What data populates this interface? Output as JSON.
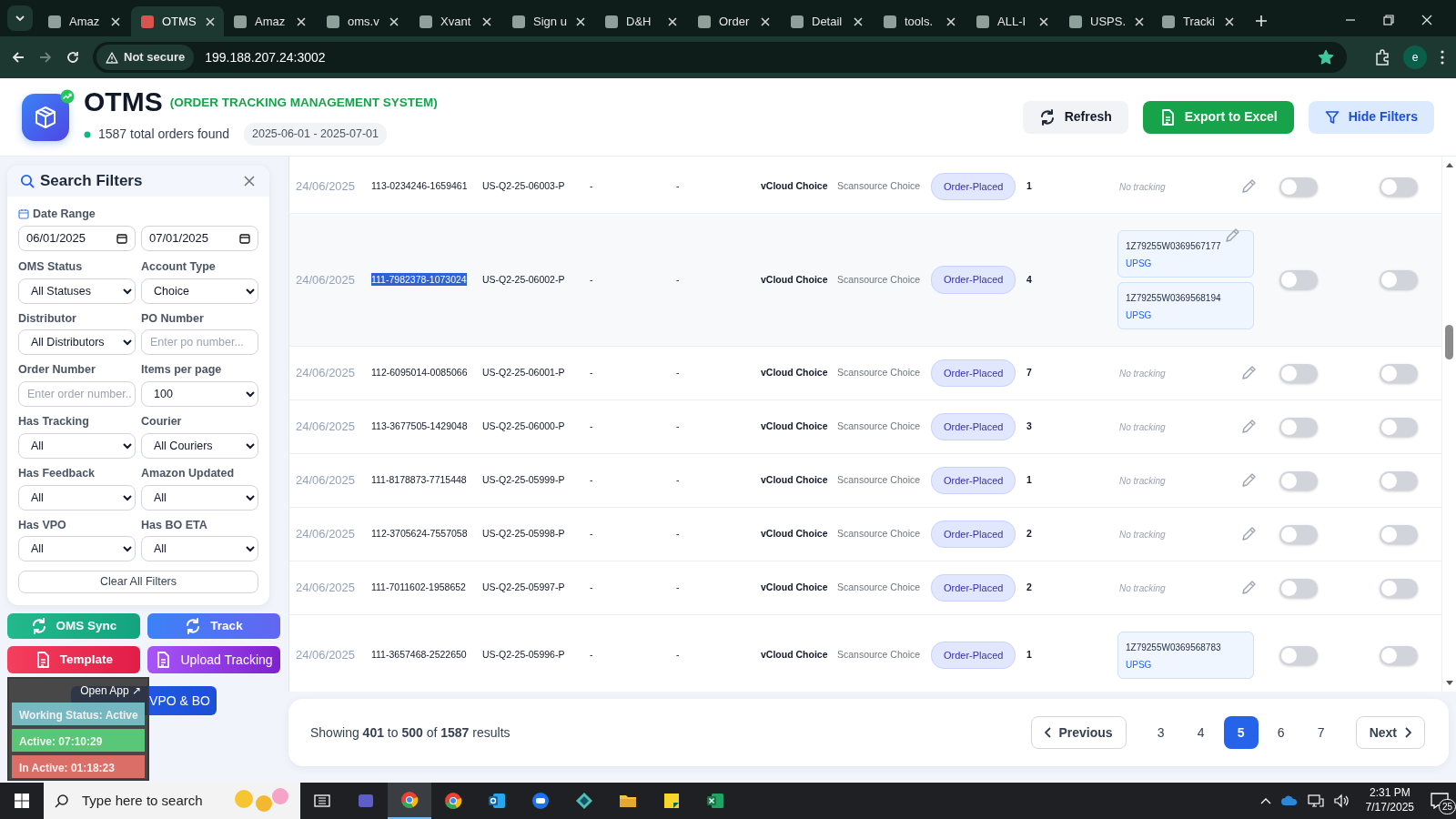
{
  "browser": {
    "tabs": [
      {
        "title": "Amaz",
        "selected": false
      },
      {
        "title": "OTMS",
        "selected": true
      },
      {
        "title": "Amaz",
        "selected": false
      },
      {
        "title": "oms.v",
        "selected": false
      },
      {
        "title": "Xvant",
        "selected": false
      },
      {
        "title": "Sign u",
        "selected": false
      },
      {
        "title": "D&H",
        "selected": false
      },
      {
        "title": "Order",
        "selected": false
      },
      {
        "title": "Detail",
        "selected": false
      },
      {
        "title": "tools.",
        "selected": false
      },
      {
        "title": "ALL-I",
        "selected": false
      },
      {
        "title": "USPS.",
        "selected": false
      },
      {
        "title": "Tracki",
        "selected": false
      }
    ],
    "security_label": "Not secure",
    "url": "199.188.207.24:3002",
    "bookmarked": true,
    "profile_initial": "e"
  },
  "header": {
    "title": "OTMS",
    "subtitle": "(ORDER TRACKING MANAGEMENT SYSTEM)",
    "order_count": "1587 total orders found",
    "date_range": "2025-06-01 - 2025-07-01",
    "buttons": [
      {
        "label": "Refresh",
        "kind": "refresh"
      },
      {
        "label": "Export to Excel",
        "kind": "export"
      },
      {
        "label": "Hide Filters",
        "kind": "filter"
      }
    ]
  },
  "filters": {
    "title": "Search Filters",
    "date_range_label": "Date Range",
    "date_from": "06/01/2025",
    "date_to": "07/01/2025",
    "fields": [
      {
        "label": "OMS Status",
        "kind": "select",
        "value": "All Statuses"
      },
      {
        "label": "Account Type",
        "kind": "select",
        "value": "Choice"
      },
      {
        "label": "Distributor",
        "kind": "select",
        "value": "All Distributors"
      },
      {
        "label": "PO Number",
        "kind": "input",
        "placeholder": "Enter po number..."
      },
      {
        "label": "Order Number",
        "kind": "input",
        "placeholder": "Enter order number.."
      },
      {
        "label": "Items per page",
        "kind": "select",
        "value": "100"
      },
      {
        "label": "Has Tracking",
        "kind": "select",
        "value": "All"
      },
      {
        "label": "Courier",
        "kind": "select",
        "value": "All Couriers"
      },
      {
        "label": "Has Feedback",
        "kind": "select",
        "value": "All"
      },
      {
        "label": "Amazon Updated",
        "kind": "select",
        "value": "All"
      },
      {
        "label": "Has VPO",
        "kind": "select",
        "value": "All"
      },
      {
        "label": "Has BO ETA",
        "kind": "select",
        "value": "All"
      }
    ],
    "clear_button": "Clear All Filters"
  },
  "actions": [
    {
      "label": "OMS Sync",
      "kind": "sync"
    },
    {
      "label": "Track",
      "kind": "track"
    },
    {
      "label": "Template",
      "kind": "template"
    },
    {
      "label": "Upload Tracking",
      "kind": "upload"
    },
    {
      "label": "VPO & BO",
      "kind": "upload_wide"
    }
  ],
  "status_widget": {
    "link": "Open App ↗",
    "items": [
      {
        "label": "Working Status: Active",
        "color": "#7cc3cc"
      },
      {
        "label": "Active: 07:10:29",
        "color": "#5cd17d"
      },
      {
        "label": "In Active: 01:18:23",
        "color": "#e8736a"
      }
    ]
  },
  "orders": [
    {
      "date": "24/06/2025",
      "order_number": "113-0234246-1659461",
      "po_number": "US-Q2-25-06003-P",
      "column_4": "-",
      "column_5": "-",
      "account": "vCloud Choice",
      "distributor": "Scansource Choice",
      "status": "Order-Placed",
      "quantity": "1",
      "no_tracking": "No tracking",
      "editable": true,
      "toggle_1": false,
      "toggle_2": false,
      "highlighted": false,
      "order_selected": false
    },
    {
      "date": "24/06/2025",
      "order_number": "111-7982378-1073024",
      "po_number": "US-Q2-25-06002-P",
      "column_4": "-",
      "column_5": "-",
      "account": "vCloud Choice",
      "distributor": "Scansource Choice",
      "status": "Order-Placed",
      "quantity": "4",
      "tracking": [
        {
          "number": "1Z79255W0369567177",
          "courier": "UPSG"
        },
        {
          "number": "1Z79255W0369568194",
          "courier": "UPSG"
        }
      ],
      "editable": true,
      "toggle_1": false,
      "toggle_2": false,
      "highlighted": true,
      "order_selected": true
    },
    {
      "date": "24/06/2025",
      "order_number": "112-6095014-0085066",
      "po_number": "US-Q2-25-06001-P",
      "column_4": "-",
      "column_5": "-",
      "account": "vCloud Choice",
      "distributor": "Scansource Choice",
      "status": "Order-Placed",
      "quantity": "7",
      "no_tracking": "No tracking",
      "editable": true,
      "toggle_1": false,
      "toggle_2": false,
      "highlighted": false,
      "order_selected": false
    },
    {
      "date": "24/06/2025",
      "order_number": "113-3677505-1429048",
      "po_number": "US-Q2-25-06000-P",
      "column_4": "-",
      "column_5": "-",
      "account": "vCloud Choice",
      "distributor": "Scansource Choice",
      "status": "Order-Placed",
      "quantity": "3",
      "no_tracking": "No tracking",
      "editable": true,
      "toggle_1": false,
      "toggle_2": false,
      "highlighted": false,
      "order_selected": false
    },
    {
      "date": "24/06/2025",
      "order_number": "111-8178873-7715448",
      "po_number": "US-Q2-25-05999-P",
      "column_4": "-",
      "column_5": "-",
      "account": "vCloud Choice",
      "distributor": "Scansource Choice",
      "status": "Order-Placed",
      "quantity": "1",
      "no_tracking": "No tracking",
      "editable": true,
      "toggle_1": false,
      "toggle_2": false,
      "highlighted": false,
      "order_selected": false
    },
    {
      "date": "24/06/2025",
      "order_number": "112-3705624-7557058",
      "po_number": "US-Q2-25-05998-P",
      "column_4": "-",
      "column_5": "-",
      "account": "vCloud Choice",
      "distributor": "Scansource Choice",
      "status": "Order-Placed",
      "quantity": "2",
      "no_tracking": "No tracking",
      "editable": true,
      "toggle_1": false,
      "toggle_2": false,
      "highlighted": false,
      "order_selected": false
    },
    {
      "date": "24/06/2025",
      "order_number": "111-7011602-1958652",
      "po_number": "US-Q2-25-05997-P",
      "column_4": "-",
      "column_5": "-",
      "account": "vCloud Choice",
      "distributor": "Scansource Choice",
      "status": "Order-Placed",
      "quantity": "2",
      "no_tracking": "No tracking",
      "editable": true,
      "toggle_1": false,
      "toggle_2": false,
      "highlighted": false,
      "order_selected": false
    },
    {
      "date": "24/06/2025",
      "order_number": "111-3657468-2522650",
      "po_number": "US-Q2-25-05996-P",
      "column_4": "-",
      "column_5": "-",
      "account": "vCloud Choice",
      "distributor": "Scansource Choice",
      "status": "Order-Placed",
      "quantity": "1",
      "tracking": [
        {
          "number": "1Z79255W0369568783",
          "courier": "UPSG"
        }
      ],
      "editable": false,
      "toggle_1": false,
      "toggle_2": false,
      "highlighted": false,
      "order_selected": false
    }
  ],
  "pagination": {
    "summary": "Showing **401** to **500** of **1587** results",
    "previous": "Previous",
    "next": "Next",
    "pages": [
      {
        "label": "3",
        "selected": false
      },
      {
        "label": "4",
        "selected": false
      },
      {
        "label": "5",
        "selected": true
      },
      {
        "label": "6",
        "selected": false
      },
      {
        "label": "7",
        "selected": false
      }
    ]
  },
  "taskbar": {
    "search_placeholder": "Type here to search",
    "time": "2:31 PM",
    "date": "7/17/2025",
    "notification_count": "25"
  }
}
